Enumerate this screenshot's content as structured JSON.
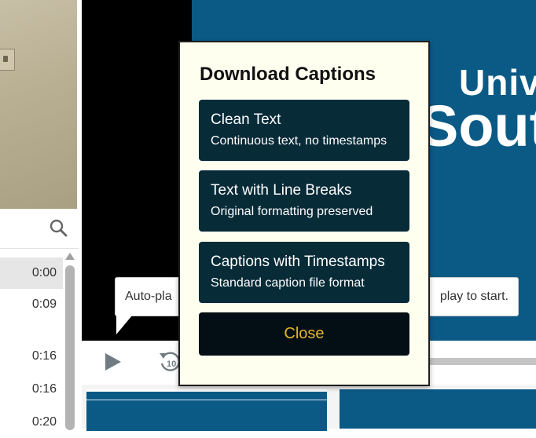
{
  "slide": {
    "line1": "Univ",
    "line2": "Sout"
  },
  "tooltips": {
    "left": "Auto-pla",
    "right": "play to start."
  },
  "transcript": {
    "timestamps": [
      "0:00",
      "0:09",
      "0:16",
      "0:16",
      "0:20"
    ]
  },
  "controls": {
    "rewind_label": "10"
  },
  "modal": {
    "title": "Download Captions",
    "options": [
      {
        "title": "Clean Text",
        "subtitle": "Continuous text, no timestamps"
      },
      {
        "title": "Text with Line Breaks",
        "subtitle": "Original formatting preserved"
      },
      {
        "title": "Captions with Timestamps",
        "subtitle": "Standard caption file format"
      }
    ],
    "close_label": "Close"
  },
  "colors": {
    "option_bg": "#082b38",
    "close_bg": "#030f14",
    "close_text": "#e5b52a",
    "modal_bg": "#fffff0",
    "slide_bg": "#0b5a86"
  },
  "icons": [
    "search-icon",
    "play-icon",
    "rewind-10-icon",
    "scroll-up-icon"
  ]
}
